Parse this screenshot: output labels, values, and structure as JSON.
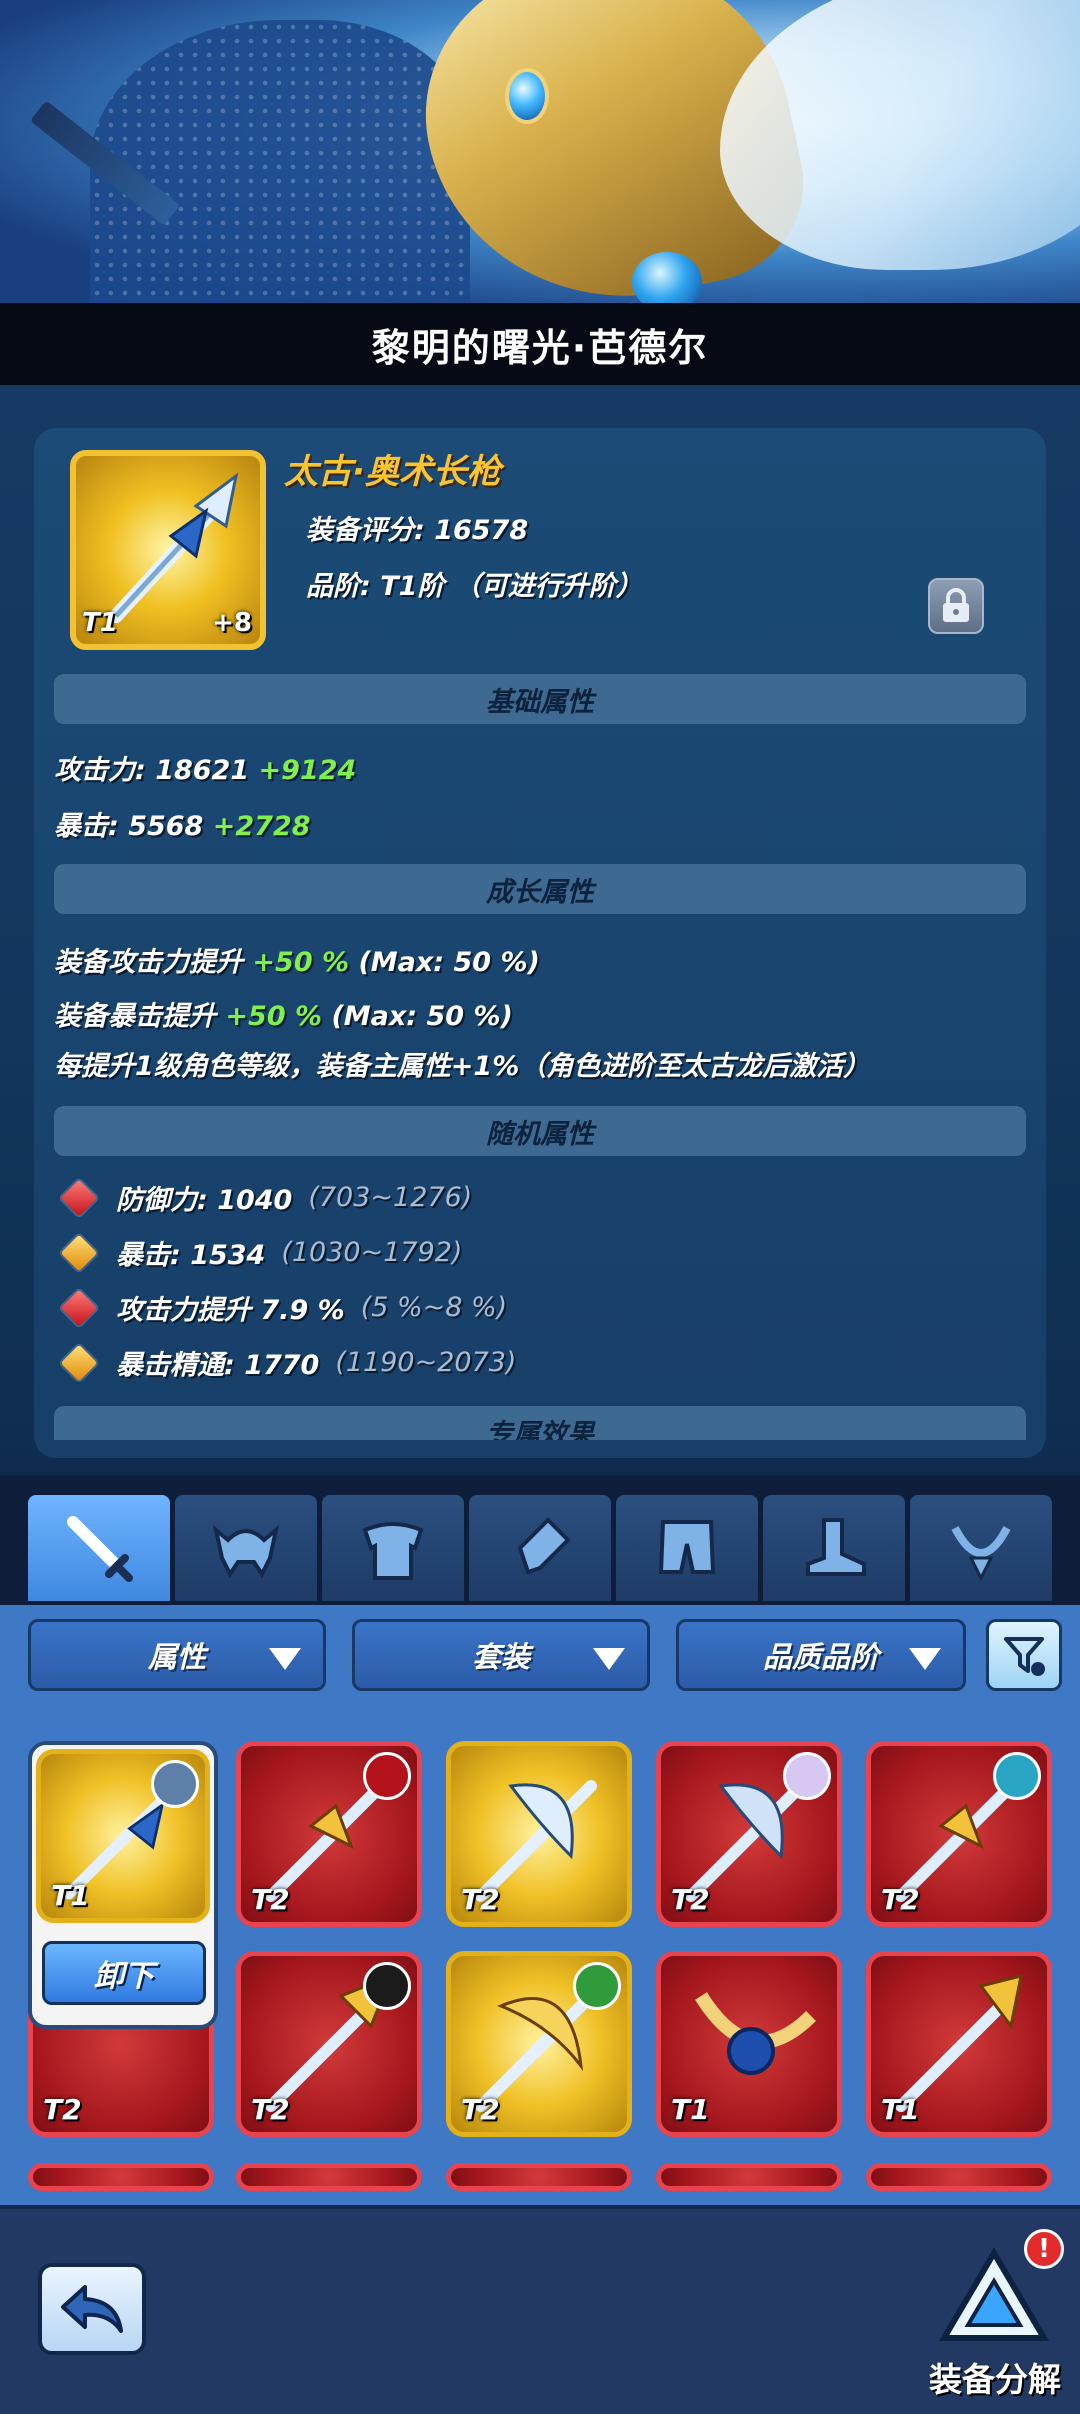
{
  "hero": {
    "name": "黎明的曙光·芭德尔"
  },
  "item": {
    "name": "太古·奥术长枪",
    "score_label": "装备评分: 16578",
    "grade_label": "品阶: T1阶 （可进行升阶）",
    "tier": "T1",
    "enhance": "+8"
  },
  "sections": {
    "basic": "基础属性",
    "growth": "成长属性",
    "random": "随机属性",
    "exclusive": "专属效果"
  },
  "basic_stats": [
    {
      "label": "攻击力: 18621",
      "bonus": "+9124"
    },
    {
      "label": "暴击: 5568",
      "bonus": "+2728"
    }
  ],
  "growth_stats": [
    {
      "label": "装备攻击力提升",
      "bonus": "+50 %",
      "max": "(Max: 50 %)"
    },
    {
      "label": "装备暴击提升",
      "bonus": "+50 %",
      "max": "(Max: 50 %)"
    }
  ],
  "growth_note": "每提升1级角色等级，装备主属性+1%（角色进阶至太古龙后激活）",
  "random_stats": [
    {
      "label": "防御力: 1040",
      "range": "(703~1276)",
      "gem": "red"
    },
    {
      "label": "暴击: 1534",
      "range": "(1030~1792)",
      "gem": "gold"
    },
    {
      "label": "攻击力提升 7.9 %",
      "range": "(5 %~8 %)",
      "gem": "red"
    },
    {
      "label": "暴击精通: 1770",
      "range": "(1190~2073)",
      "gem": "gold"
    }
  ],
  "tabs": [
    "sword-icon",
    "helmet-icon",
    "armor-icon",
    "bracer-icon",
    "pants-icon",
    "boots-icon",
    "necklace-icon"
  ],
  "filters": {
    "attribute": "属性",
    "set": "套装",
    "quality": "品质品阶"
  },
  "inventory": {
    "unequip_label": "卸下",
    "slots": [
      {
        "tier": "T1",
        "rarity": "gold",
        "equipped": true
      },
      {
        "tier": "T2",
        "rarity": "red"
      },
      {
        "tier": "T2",
        "rarity": "gold"
      },
      {
        "tier": "T2",
        "rarity": "red"
      },
      {
        "tier": "T2",
        "rarity": "red"
      },
      {
        "tier": "T2",
        "rarity": "red"
      },
      {
        "tier": "T2",
        "rarity": "red"
      },
      {
        "tier": "T2",
        "rarity": "gold"
      },
      {
        "tier": "T1",
        "rarity": "red"
      },
      {
        "tier": "T1",
        "rarity": "red"
      }
    ]
  },
  "bottom": {
    "salvage_label": "装备分解",
    "alert": "!"
  },
  "colors": {
    "gold_rarity": "#f0c126",
    "red_rarity": "#c4262c",
    "bonus_green": "#7ff04c",
    "item_name_gold": "#f7c531"
  }
}
